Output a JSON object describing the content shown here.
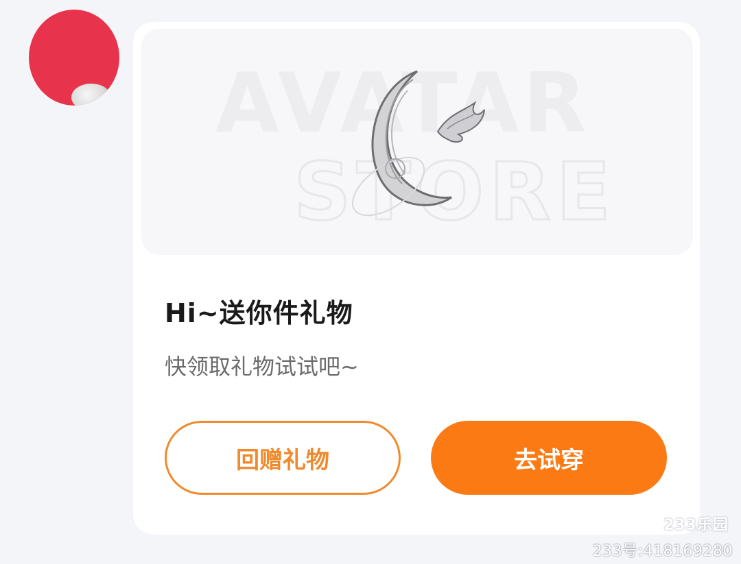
{
  "chat": {
    "sender_avatar": "avatar-redacted",
    "gift_card": {
      "banner": {
        "text_line1": "AVATAR",
        "text_line2": "STORE",
        "image": "crescent-moon-hairpin-gift"
      },
      "title": "Hi~送你件礼物",
      "subtitle": "快领取礼物试试吧~",
      "return_gift_label": "回赠礼物",
      "try_on_label": "去试穿"
    }
  },
  "watermark": {
    "logo": "233乐园",
    "id_text": "233号:418169280"
  },
  "colors": {
    "page_bg": "#f4f5f9",
    "card_bg": "#ffffff",
    "accent": "#fb7a14",
    "accent_outline": "#f08a2c",
    "avatar_red": "#e8334c"
  }
}
